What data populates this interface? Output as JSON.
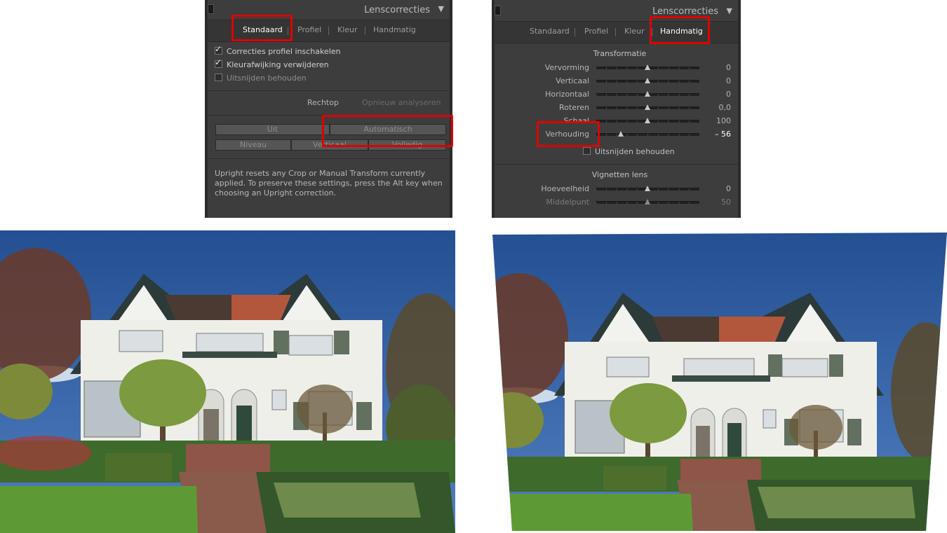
{
  "left_panel": {
    "title": "Lenscorrecties",
    "tabs": [
      "Standaard",
      "Profiel",
      "Kleur",
      "Handmatig"
    ],
    "active_tab": "Standaard",
    "checkboxes": [
      {
        "label": "Correcties profiel inschakelen",
        "checked": true
      },
      {
        "label": "Kleurafwijking verwijderen",
        "checked": true
      },
      {
        "label": "Uitsnijden behouden",
        "checked": false
      }
    ],
    "upright_label": "Rechtop",
    "reanalyze_label": "Opnieuw analyseren",
    "upright_buttons": [
      "Uit",
      "Automatisch",
      "Niveau",
      "Verticaal",
      "Volledig"
    ],
    "note": "Upright resets any Crop or Manual Transform currently applied. To preserve these settings, press the Alt key when choosing an Upright correction."
  },
  "right_panel": {
    "title": "Lenscorrecties",
    "tabs": [
      "Standaard",
      "Profiel",
      "Kleur",
      "Handmatig"
    ],
    "active_tab": "Handmatig",
    "transform_section": "Transformatie",
    "sliders": [
      {
        "label": "Vervorming",
        "value": "0",
        "level": 0.5
      },
      {
        "label": "Verticaal",
        "value": "0",
        "level": 0.5
      },
      {
        "label": "Horizontaal",
        "value": "0",
        "level": 0.5
      },
      {
        "label": "Roteren",
        "value": "0,0",
        "level": 0.5
      },
      {
        "label": "Schaal",
        "value": "100",
        "level": 0.5
      },
      {
        "label": "Verhouding",
        "value": "– 56",
        "level": 0.24
      }
    ],
    "keep_crop_label": "Uitsnijden behouden",
    "vignette_section": "Vignetten lens",
    "vignette_sliders": [
      {
        "label": "Hoeveelheid",
        "value": "0",
        "level": 0.5
      },
      {
        "label": "Middelpunt",
        "value": "50",
        "level": 0.5
      }
    ]
  },
  "colors": {
    "highlight": "#e00000",
    "panel_bg": "#3d3d3d",
    "sky": "#2f5da0",
    "lawn": "#4f8a2b"
  },
  "icons": [
    "panel-grip-icon",
    "collapse-triangle-icon",
    "checkmark-icon",
    "slider-thumb-icon"
  ]
}
